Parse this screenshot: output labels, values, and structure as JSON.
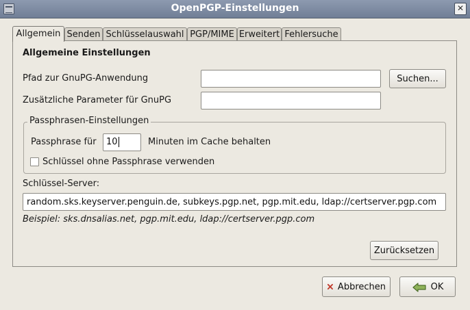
{
  "window": {
    "title": "OpenPGP-Einstellungen",
    "close_glyph": "✕"
  },
  "tabs": [
    {
      "label": "Allgemein",
      "active": true
    },
    {
      "label": "Senden",
      "active": false
    },
    {
      "label": "Schlüsselauswahl",
      "active": false
    },
    {
      "label": "PGP/MIME",
      "active": false
    },
    {
      "label": "Erweitert",
      "active": false
    },
    {
      "label": "Fehlersuche",
      "active": false
    }
  ],
  "general": {
    "heading": "Allgemeine Einstellungen",
    "gnupg_path_label": "Pfad zur GnuPG-Anwendung",
    "gnupg_path_value": "",
    "browse_label": "Suchen...",
    "gnupg_params_label": "Zusätzliche Parameter für GnuPG",
    "gnupg_params_value": ""
  },
  "passphrase": {
    "group_label": "Passphrasen-Einstellungen",
    "prefix_label": "Passphrase für",
    "minutes_value": "10",
    "suffix_label": "Minuten im Cache behalten",
    "no_passphrase_label": "Schlüssel ohne Passphrase verwenden",
    "no_passphrase_checked": false
  },
  "keyserver": {
    "label": "Schlüssel-Server:",
    "value": "random.sks.keyserver.penguin.de, subkeys.pgp.net, pgp.mit.edu, ldap://certserver.pgp.com",
    "example": "Beispiel: sks.dnsalias.net, pgp.mit.edu, ldap://certserver.pgp.com"
  },
  "reset_label": "Zurücksetzen",
  "footer": {
    "cancel_label": "Abbrechen",
    "ok_label": "OK"
  },
  "colors": {
    "titlebar": "#7e8aa2",
    "window_bg": "#ece9e1",
    "cancel_icon": "#c0392b",
    "ok_icon": "#5b8a3a"
  }
}
